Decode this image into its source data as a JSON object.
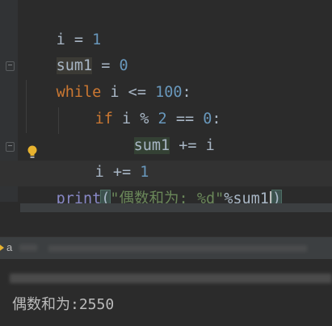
{
  "editor": {
    "lines": {
      "l1": {
        "var": "i",
        "op": " = ",
        "num": "1"
      },
      "l2": {
        "var": "sum1",
        "op": " = ",
        "num": "0"
      },
      "l3": {
        "kw": "while",
        "mid": " i <= ",
        "num": "100",
        "end": ":"
      },
      "l4": {
        "kw": "if",
        "mid": " i % ",
        "num1": "2",
        "eq": " == ",
        "num2": "0",
        "end": ":"
      },
      "l5": {
        "var": "sum1",
        "rest": " += i"
      },
      "l6": {
        "text": "i += ",
        "num": "1"
      },
      "l7": {
        "fn": "print",
        "open": "(",
        "str": "\"偶数和为: %d\"",
        "pct": "%",
        "arg1": "sum",
        "arg2": "1",
        "close": ")"
      }
    }
  },
  "icons": {
    "bulb": "lightbulb-icon",
    "fold": "fold-icon",
    "run": "run-icon"
  },
  "run_panel": {
    "tab_label": "a",
    "output": "偶数和为:2550"
  },
  "colors": {
    "background": "#2b2b2b",
    "keyword": "#cc7832",
    "number": "#6897bb",
    "string": "#6a8759",
    "builtin": "#8888c6",
    "text": "#a9b7c6"
  }
}
